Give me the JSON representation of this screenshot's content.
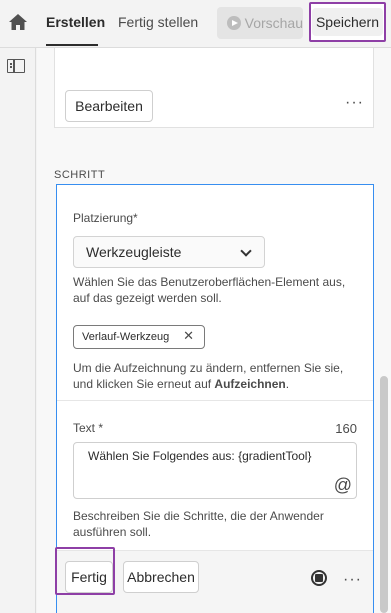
{
  "header": {
    "tabs": [
      {
        "label": "Erstellen",
        "active": true
      },
      {
        "label": "Fertig stellen",
        "active": false
      }
    ],
    "preview_label": "Vorschau",
    "save_label": "Speichern"
  },
  "previous_step": {
    "edit_label": "Bearbeiten",
    "more_label": "···"
  },
  "step": {
    "section_label": "SCHRITT",
    "placement_label": "Platzierung*",
    "placement_value": "Werkzeugleiste",
    "placement_help": "Wählen Sie das Benutzeroberflächen-Element aus, auf das gezeigt werden soll.",
    "target_tag": "Verlauf-Werkzeug",
    "record_help_prefix": "Um die Aufzeichnung zu ändern, entfernen Sie sie, und klicken Sie erneut auf ",
    "record_help_action": "Aufzeichnen",
    "record_help_suffix": ".",
    "text_label": "Text *",
    "char_count": "160",
    "text_value": "Wählen Sie Folgendes aus: {gradientTool}",
    "text_help": "Beschreiben Sie die Schritte, die der Anwender ausführen soll.",
    "done_label": "Fertig",
    "cancel_label": "Abbrechen",
    "more_label": "···"
  },
  "icons": {
    "home": "home-icon",
    "panel": "panel-toggle-icon",
    "play": "play-icon",
    "chevron": "chevron-down-icon",
    "remove": "close-icon",
    "at": "at-sign-icon",
    "stop": "stop-record-icon"
  },
  "colors": {
    "highlight": "#8e3fa6",
    "focus_border": "#378ef0"
  }
}
